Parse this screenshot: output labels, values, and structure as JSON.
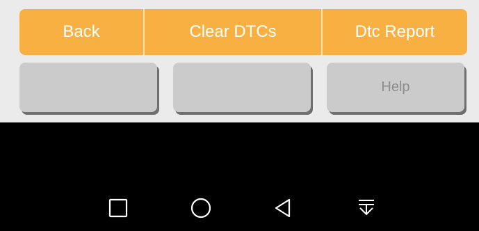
{
  "top_bar": {
    "back_label": "Back",
    "clear_label": "Clear DTCs",
    "report_label": "Dtc Report"
  },
  "bottom_row": {
    "button1_label": "",
    "button2_label": "",
    "help_label": "Help"
  },
  "nav_bar": {
    "icons": [
      "square-recents-icon",
      "circle-home-icon",
      "triangle-back-icon",
      "notification-pull-icon"
    ]
  },
  "colors": {
    "accent": "#f8b043",
    "panel_bg": "#ebebeb",
    "gray_button": "#cbcbcb",
    "nav_bg": "#000000"
  }
}
